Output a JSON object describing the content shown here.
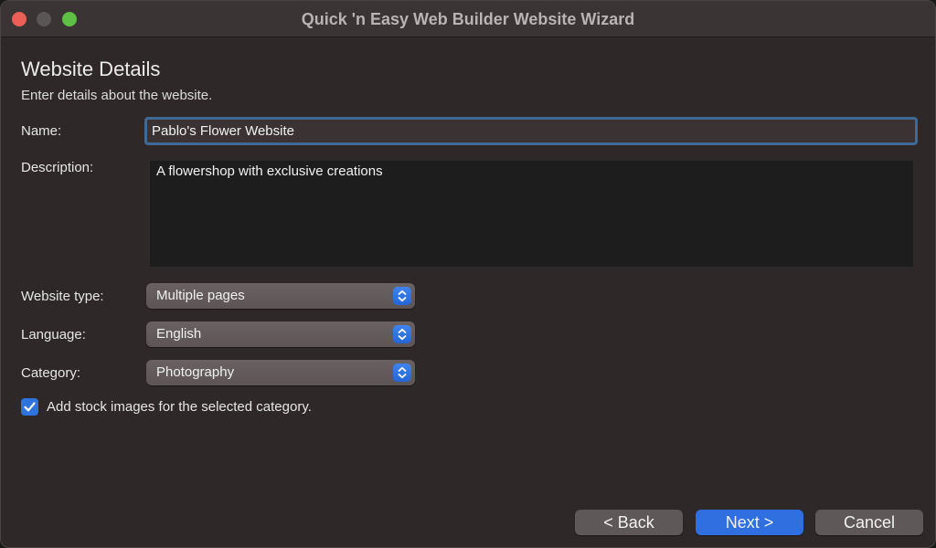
{
  "window": {
    "title": "Quick 'n Easy Web Builder Website Wizard"
  },
  "page": {
    "heading": "Website Details",
    "subheading": "Enter details about the website."
  },
  "form": {
    "name_label": "Name:",
    "name_value": "Pablo's Flower Website",
    "description_label": "Description:",
    "description_value": "A flowershop with exclusive creations",
    "website_type_label": "Website type:",
    "website_type_value": "Multiple pages",
    "language_label": "Language:",
    "language_value": "English",
    "category_label": "Category:",
    "category_value": "Photography",
    "stock_images_label": "Add stock images for the selected category.",
    "stock_images_checked": true
  },
  "buttons": {
    "back": "< Back",
    "next": "Next >",
    "cancel": "Cancel"
  },
  "colors": {
    "accent": "#2f6fe0",
    "window_bg": "#2f2828",
    "close": "#ec5f57",
    "maximize": "#5ebf45"
  }
}
